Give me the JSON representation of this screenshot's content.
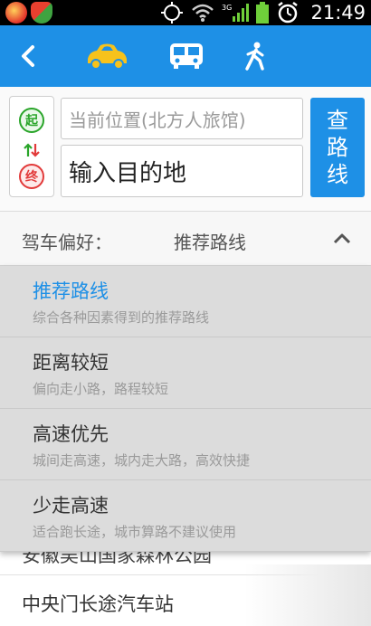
{
  "status_bar": {
    "time": "21:49",
    "network": "3G"
  },
  "title_bar": {
    "modes": [
      {
        "name": "car",
        "icon": "car-icon",
        "selected": true
      },
      {
        "name": "bus",
        "icon": "bus-icon",
        "selected": false
      },
      {
        "name": "walk",
        "icon": "walk-icon",
        "selected": false
      }
    ],
    "accent_color": "#1e90e6",
    "car_color": "#f6c21c"
  },
  "route": {
    "start_badge": "起",
    "end_badge": "终",
    "origin_value": "当前位置(北方人旅馆)",
    "destination_placeholder": "输入目的地",
    "search_label_lines": [
      "查",
      "路",
      "线"
    ]
  },
  "preference": {
    "label": "驾车偏好：",
    "value": "推荐路线"
  },
  "options": [
    {
      "title": "推荐路线",
      "desc": "综合各种因素得到的推荐路线",
      "selected": true
    },
    {
      "title": "距离较短",
      "desc": "偏向走小路，路程较短",
      "selected": false
    },
    {
      "title": "高速优先",
      "desc": "城间走高速，城内走大路，高效快捷",
      "selected": false
    },
    {
      "title": "少走高速",
      "desc": "适合跑长途，城市算路不建议使用",
      "selected": false
    }
  ],
  "background_list": [
    {
      "text": "安徽吴山国家森林公园"
    },
    {
      "text": "中央门长途汽车站"
    }
  ]
}
